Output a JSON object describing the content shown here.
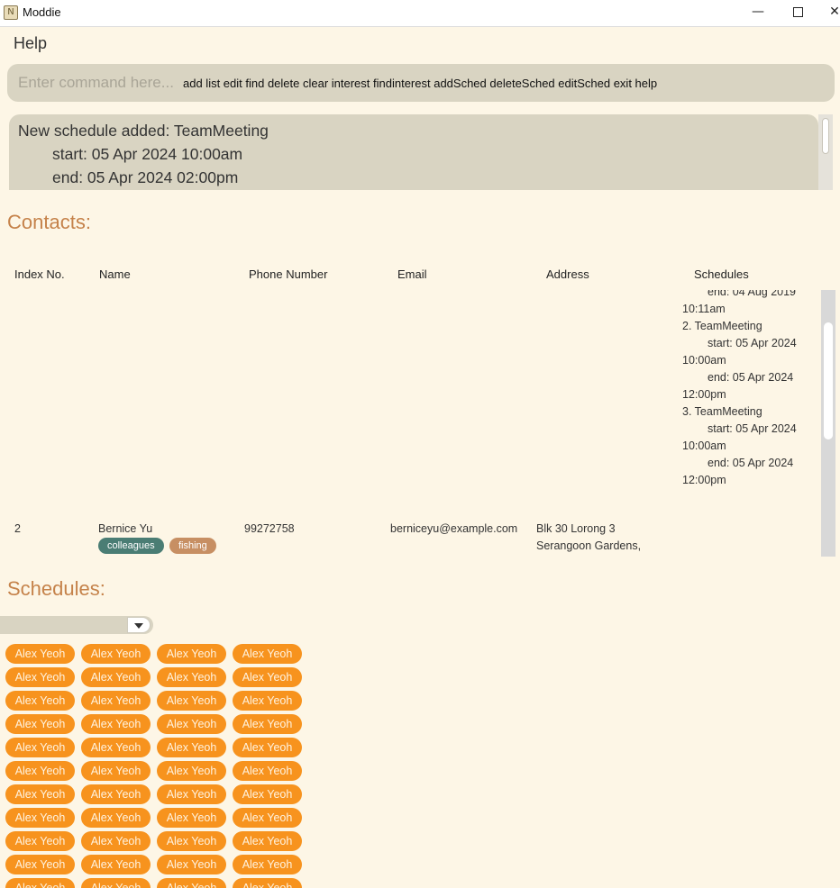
{
  "window": {
    "title": "Moddie",
    "minimize_glyph": "—",
    "close_glyph": "✕"
  },
  "menu": {
    "help": "Help"
  },
  "command": {
    "placeholder": "Enter command here...",
    "hint": "add list edit find delete clear interest findinterest addSched deleteSched editSched exit help"
  },
  "result": {
    "lines": [
      "New schedule added: TeamMeeting",
      "start: 05 Apr 2024 10:00am",
      "end: 05 Apr 2024 02:00pm"
    ]
  },
  "contacts": {
    "title": "Contacts:",
    "columns": [
      "Index No.",
      "Name",
      "Phone Number",
      "Email",
      "Address",
      "Schedules"
    ],
    "schedule_lines": [
      "end: 04 Aug 2019",
      "10:11am",
      "2. TeamMeeting",
      "start: 05 Apr 2024",
      "10:00am",
      "end: 05 Apr 2024",
      "12:00pm",
      "3. TeamMeeting",
      "start: 05 Apr 2024",
      "10:00am",
      "end: 05 Apr 2024",
      "12:00pm"
    ],
    "row2": {
      "index": "2",
      "name": "Bernice Yu",
      "phone": "99272758",
      "email": "berniceyu@example.com",
      "address_lines": [
        "Blk 30 Lorong 3",
        "Serangoon Gardens,"
      ],
      "tags": [
        "colleagues",
        "fishing"
      ]
    }
  },
  "schedules": {
    "title": "Schedules:",
    "selected": "",
    "chip_label": "Alex Yeoh",
    "chip_columns": 4,
    "chip_rows": 11
  },
  "colors": {
    "background": "#fdf6e6",
    "accent_title": "#c5824a",
    "chip": "#f7931e",
    "tag_colleagues": "#4a7d74",
    "tag_fishing": "#c78f63",
    "panel": "#d9d4c2"
  }
}
